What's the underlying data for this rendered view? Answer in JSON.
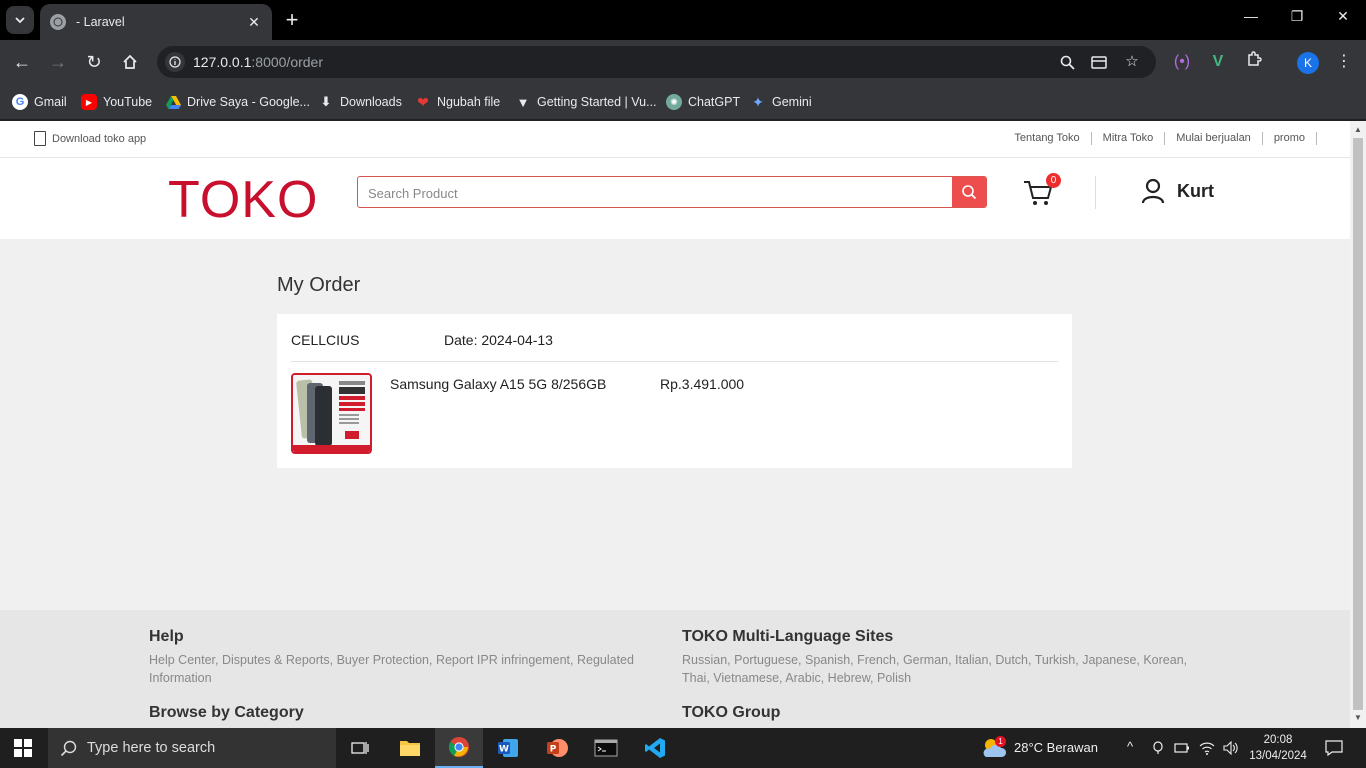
{
  "browser": {
    "tab_title": "- Laravel",
    "url_host": "127.0.0.1",
    "url_rest": ":8000/order",
    "profile_initial": "K",
    "bookmarks": [
      {
        "label": "Gmail",
        "icon": "gmail-icon"
      },
      {
        "label": "YouTube",
        "icon": "youtube-icon"
      },
      {
        "label": "Drive Saya - Google...",
        "icon": "drive-icon"
      },
      {
        "label": "Downloads",
        "icon": "download-icon"
      },
      {
        "label": "Ngubah file",
        "icon": "heart-icon"
      },
      {
        "label": "Getting Started | Vu...",
        "icon": "vuetify-icon"
      },
      {
        "label": "ChatGPT",
        "icon": "chatgpt-icon"
      },
      {
        "label": "Gemini",
        "icon": "gemini-icon"
      }
    ]
  },
  "topbar": {
    "download_app": "Download toko app",
    "links": [
      "Tentang Toko",
      "Mitra Toko",
      "Mulai berjualan",
      "promo"
    ]
  },
  "header": {
    "logo": "TOKO",
    "search_placeholder": "Search Product",
    "cart_count": "0",
    "user_name": "Kurt"
  },
  "main": {
    "title": "My Order",
    "order": {
      "store": "CELLCIUS",
      "date": "Date: 2024-04-13",
      "item_name": "Samsung Galaxy A15 5G 8/256GB",
      "item_price": "Rp.3.491.000"
    }
  },
  "footer": {
    "help_title": "Help",
    "help_text": "Help Center, Disputes & Reports, Buyer Protection, Report IPR infringement, Regulated Information",
    "lang_title": "TOKO Multi-Language Sites",
    "lang_text": "Russian, Portuguese, Spanish, French, German, Italian, Dutch, Turkish, Japanese, Korean, Thai, Vietnamese, Arabic, Hebrew, Polish",
    "category_title": "Browse by Category",
    "group_title": "TOKO Group"
  },
  "taskbar": {
    "search_placeholder": "Type here to search",
    "weather": "28°C  Berawan",
    "weather_badge": "1",
    "time": "20:08",
    "date": "13/04/2024"
  },
  "colors": {
    "brand": "#c8102e",
    "search_button": "#ee4d4d",
    "badge": "#ee2d2d"
  }
}
